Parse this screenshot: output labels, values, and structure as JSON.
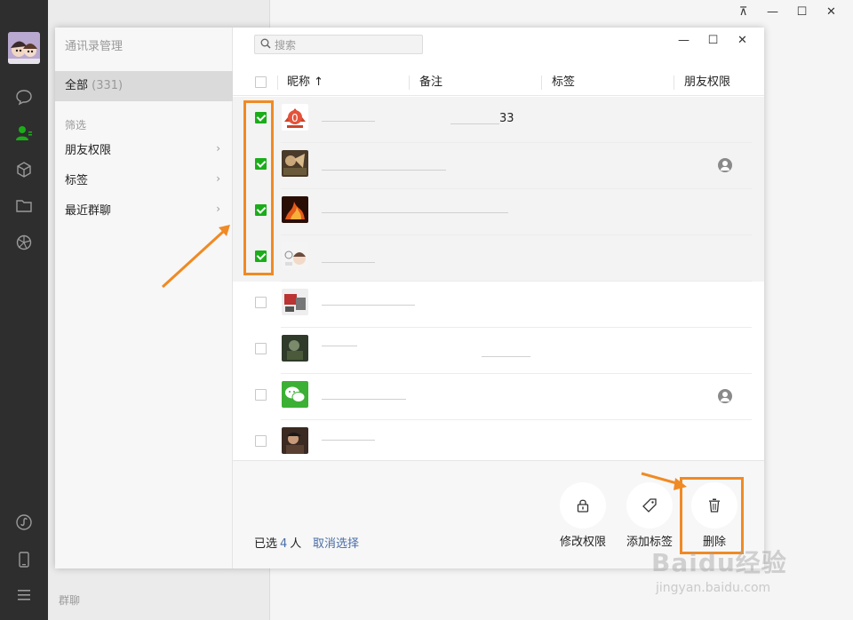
{
  "window": {
    "pin_glyph": "⊼",
    "min_glyph": "—",
    "max_glyph": "☐",
    "close_glyph": "✕"
  },
  "nav": {
    "icons": [
      "chat-icon",
      "contacts-icon",
      "favorites-icon",
      "folder-icon",
      "moments-icon",
      "miniprogram-icon",
      "phone-icon",
      "menu-icon"
    ]
  },
  "background_list": {
    "bottom_label": "群聊"
  },
  "dialog": {
    "title": "通讯录管理",
    "sidebar": {
      "all_label": "全部",
      "all_count": "(331)",
      "filter_section": "筛选",
      "items": [
        {
          "label": "朋友权限",
          "chevron": "›"
        },
        {
          "label": "标签",
          "chevron": "›"
        },
        {
          "label": "最近群聊",
          "chevron": "›"
        }
      ]
    },
    "search": {
      "placeholder": "搜索",
      "icon": "🔍"
    },
    "table": {
      "columns": [
        "昵称 ↑",
        "备注",
        "标签",
        "朋友权限"
      ],
      "rows": [
        {
          "name": "33",
          "checked": true
        },
        {
          "name": "",
          "checked": true
        },
        {
          "name": "",
          "checked": true
        },
        {
          "name": "",
          "checked": true
        },
        {
          "name": "",
          "checked": false
        },
        {
          "name": "",
          "checked": false
        },
        {
          "name": "",
          "checked": false
        },
        {
          "name": "",
          "checked": false
        }
      ]
    },
    "footer": {
      "selected_prefix": "已选",
      "selected_count": "4",
      "selected_suffix": "人",
      "cancel_label": "取消选择",
      "actions": [
        {
          "label": "修改权限",
          "icon": "lock-icon"
        },
        {
          "label": "添加标签",
          "icon": "tag-icon"
        },
        {
          "label": "删除",
          "icon": "trash-icon"
        }
      ]
    }
  },
  "watermark": {
    "brand": "Baidu经验",
    "url": "jingyan.baidu.com"
  },
  "colors": {
    "accent_green": "#1aad19",
    "link_blue": "#4a6da7",
    "annotation_orange": "#f08a24",
    "nav_bg": "#2e2e2e"
  }
}
